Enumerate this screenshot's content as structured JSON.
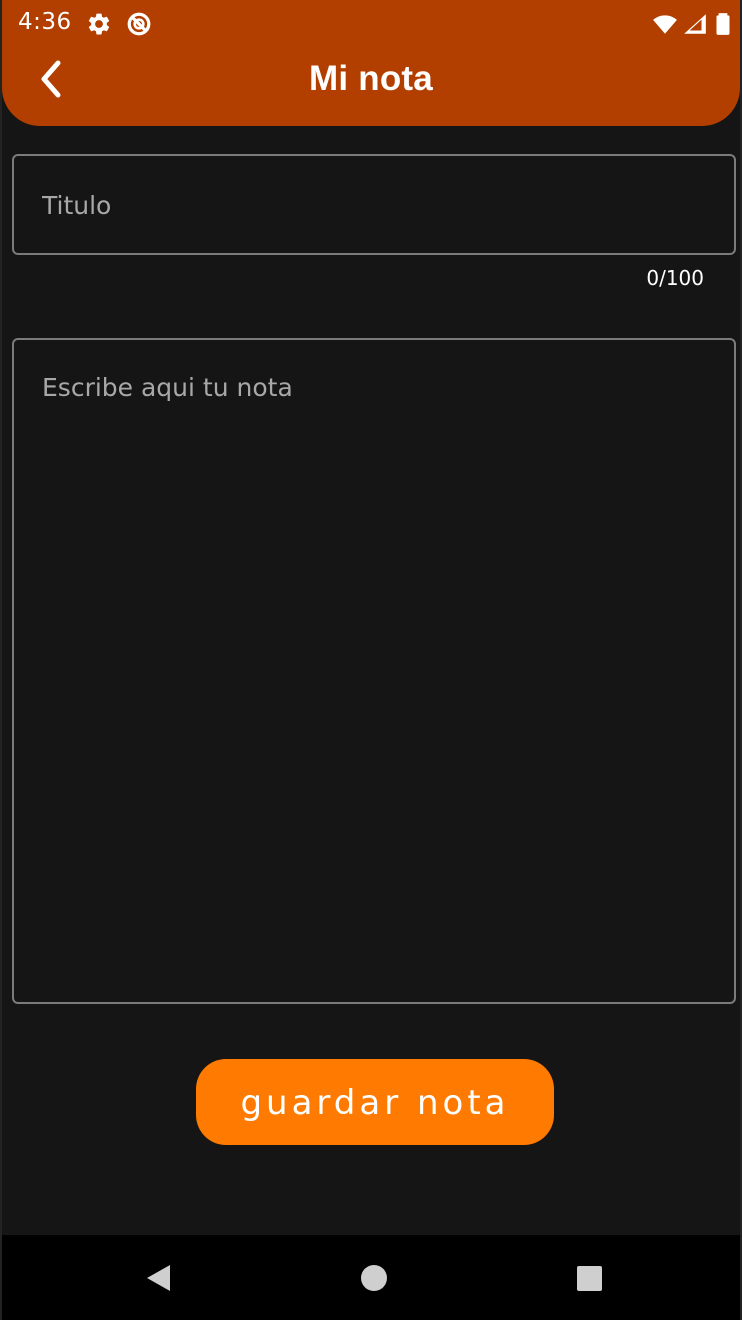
{
  "status_bar": {
    "time": "4:36",
    "icons": [
      "settings-icon",
      "do-not-disturb-icon",
      "wifi-icon",
      "signal-icon",
      "battery-icon"
    ]
  },
  "header": {
    "title": "Mi nota",
    "background": "#b23f00",
    "back_icon": "back-chevron-icon"
  },
  "form": {
    "title_placeholder": "Titulo",
    "title_value": "",
    "title_counter": "0/100",
    "note_placeholder": "Escribe aqui tu nota",
    "note_value": "",
    "save_label": "guardar nota",
    "accent": "#ff7a00"
  },
  "system_nav": {
    "items": [
      "back-triangle-icon",
      "home-circle-icon",
      "recents-square-icon"
    ]
  }
}
